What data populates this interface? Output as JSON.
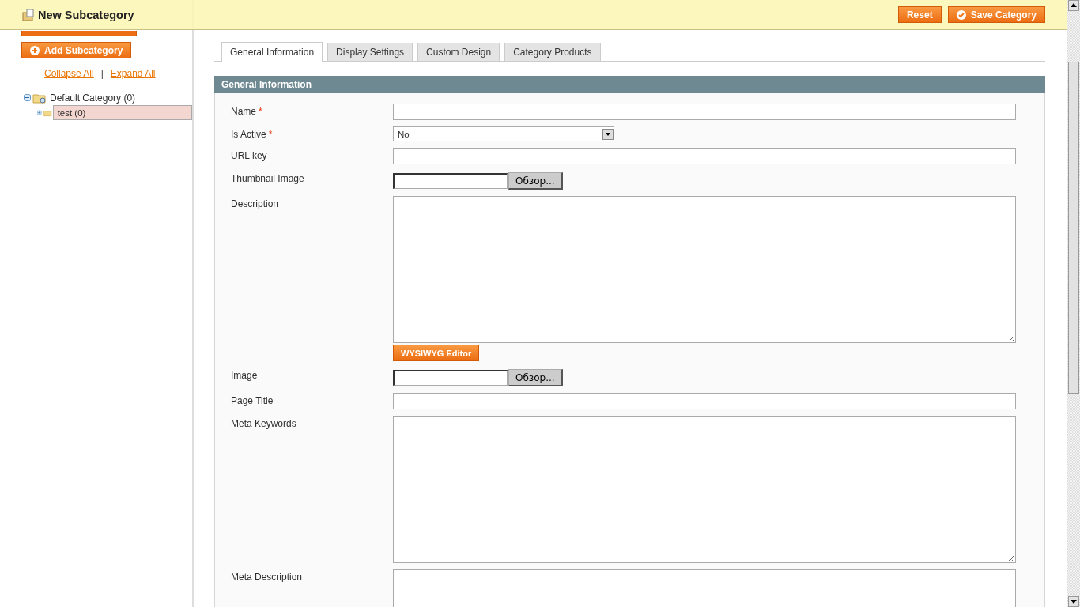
{
  "header": {
    "title": "New Subcategory",
    "buttons": [
      {
        "label": "Reset",
        "kind": "plain"
      },
      {
        "label": "Save Category",
        "kind": "save"
      }
    ]
  },
  "sidebar": {
    "add_button": "Add Subcategory",
    "collapse": "Collapse All",
    "separator": "|",
    "expand": "Expand All",
    "tree": [
      {
        "label": "Default Category (0)",
        "expanded": true,
        "selected": false,
        "children": [
          {
            "label": "test (0)",
            "expanded": false,
            "selected": true
          }
        ]
      }
    ]
  },
  "content": {
    "tabs": [
      {
        "label": "General Information",
        "selected": true
      },
      {
        "label": "Display Settings",
        "selected": false
      },
      {
        "label": "Custom Design",
        "selected": false
      },
      {
        "label": "Category Products",
        "selected": false
      }
    ],
    "section": "General Information",
    "fields": [
      {
        "label": "Name",
        "required_mark": "*",
        "kind": "text"
      },
      {
        "label": "Is Active",
        "required_mark": "*",
        "kind": "select",
        "value": "No"
      },
      {
        "label": "URL key",
        "kind": "text"
      },
      {
        "label": "Thumbnail Image",
        "kind": "file",
        "browse": "Обзор..."
      },
      {
        "label": "Description",
        "kind": "textarea",
        "editor_button": "WYSIWYG Editor"
      },
      {
        "label": "Image",
        "kind": "file",
        "browse": "Обзор..."
      },
      {
        "label": "Page Title",
        "kind": "text"
      },
      {
        "label": "Meta Keywords",
        "kind": "textarea"
      },
      {
        "label": "Meta Description",
        "kind": "textarea"
      }
    ]
  }
}
